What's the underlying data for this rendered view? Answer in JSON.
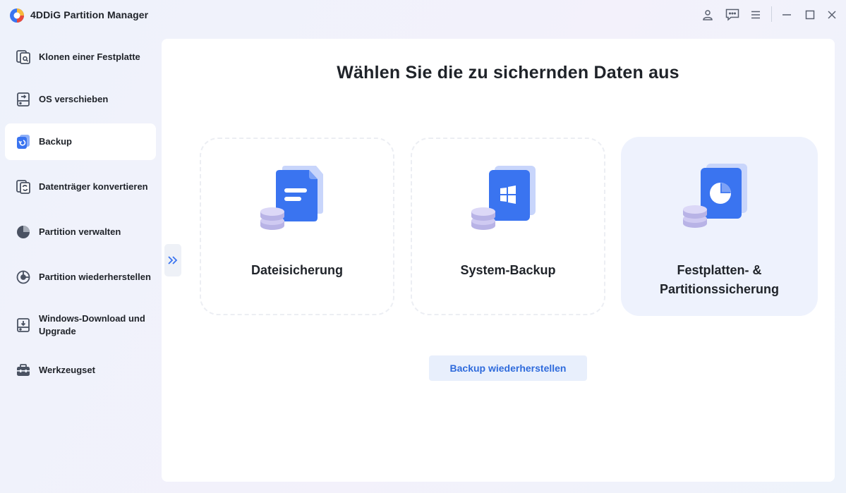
{
  "app": {
    "title": "4DDiG Partition Manager"
  },
  "titlebar": {
    "icons": [
      "account-icon",
      "feedback-icon",
      "menu-icon",
      "minimize-icon",
      "maximize-icon",
      "close-icon"
    ]
  },
  "sidebar": {
    "items": [
      {
        "label": "Klonen einer Festplatte",
        "icon": "disk-clone-icon"
      },
      {
        "label": "OS verschieben",
        "icon": "os-migrate-icon"
      },
      {
        "label": "Backup",
        "icon": "backup-icon",
        "active": true
      },
      {
        "label": "Datenträger konvertieren",
        "icon": "disk-convert-icon"
      },
      {
        "label": "Partition verwalten",
        "icon": "partition-manage-icon"
      },
      {
        "label": "Partition wiederherstellen",
        "icon": "partition-recover-icon"
      },
      {
        "label": "Windows-Download und Upgrade",
        "icon": "windows-download-icon"
      },
      {
        "label": "Werkzeugset",
        "icon": "toolbox-icon"
      }
    ]
  },
  "main": {
    "title": "Wählen Sie die zu sichernden Daten aus",
    "cards": [
      {
        "label": "Dateisicherung",
        "icon": "file-backup-icon"
      },
      {
        "label": "System-Backup",
        "icon": "system-backup-icon"
      },
      {
        "label": "Festplatten- & Partitionssicherung",
        "icon": "disk-partition-backup-icon",
        "selected": true
      }
    ],
    "restore_button": "Backup wiederherstellen"
  },
  "colors": {
    "accent": "#2f6bdc",
    "icon_blue": "#3a74f0",
    "selected_card_bg": "#eef2fd",
    "active_nav_bg": "#ffffff"
  }
}
